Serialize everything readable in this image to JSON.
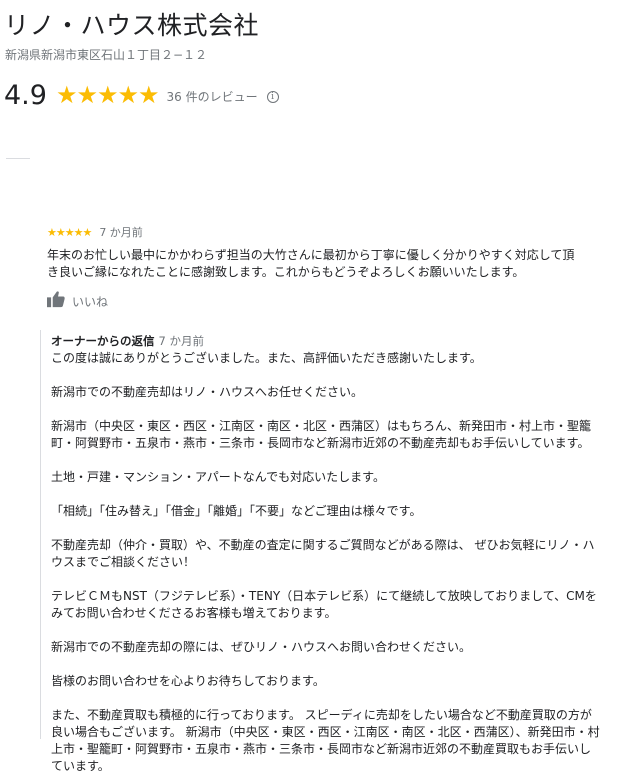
{
  "business": {
    "name": "リノ・ハウス株式会社",
    "address": "新潟県新潟市東区石山１丁目２−１２",
    "rating": "4.9",
    "stars": "★★★★★",
    "review_count": "36 件のレビュー",
    "info_icon": "info-icon"
  },
  "review": {
    "stars": "★★★★★",
    "time": "7 か月前",
    "text": "年末のお忙しい最中にかかわらず担当の大竹さんに最初から丁寧に優しく分かりやすく対応して頂き良いご縁になれたことに感謝致します。これからもどうぞよろしくお願いいたします。",
    "like_label": "いいね",
    "like_icon": "thumbs-up-icon"
  },
  "owner_reply": {
    "label": "オーナーからの返信",
    "time": "7 か月前",
    "text": "この度は誠にありがとうございました。また、高評価いただき感謝いたします。\n\n新潟市での不動産売却はリノ・ハウスへお任せください。\n\n新潟市（中央区・東区・西区・江南区・南区・北区・西蒲区）はもちろん、新発田市・村上市・聖籠町・阿賀野市・五泉市・燕市・三条市・長岡市など新潟市近郊の不動産売却もお手伝いしています。\n\n土地・戸建・マンション・アパートなんでも対応いたします。\n\n「相続」「住み替え」「借金」「離婚」「不要」などご理由は様々です。\n\n不動産売却（仲介・買取）や、不動産の査定に関するご質問などがある際は、 ぜひお気軽にリノ・ハウスまでご相談ください！\n\nテレビＣＭもNST（フジテレビ系）・TENY（日本テレビ系）にて継続して放映しておりまして、CMをみてお問い合わせくださるお客様も増えております。\n\n新潟市での不動産売却の際には、ぜひリノ・ハウスへお問い合わせください。\n\n皆様のお問い合わせを心よりお待ちしております。\n\nまた、不動産買取も積極的に行っております。 スピーディに売却をしたい場合など不動産買取の方が良い場合もございます。 新潟市（中央区・東区・西区・江南区・南区・北区・西蒲区）、新発田市・村上市・聖籠町・阿賀野市・五泉市・燕市・三条市・長岡市など新潟市近郊の不動産買取もお手伝いしています。"
  }
}
